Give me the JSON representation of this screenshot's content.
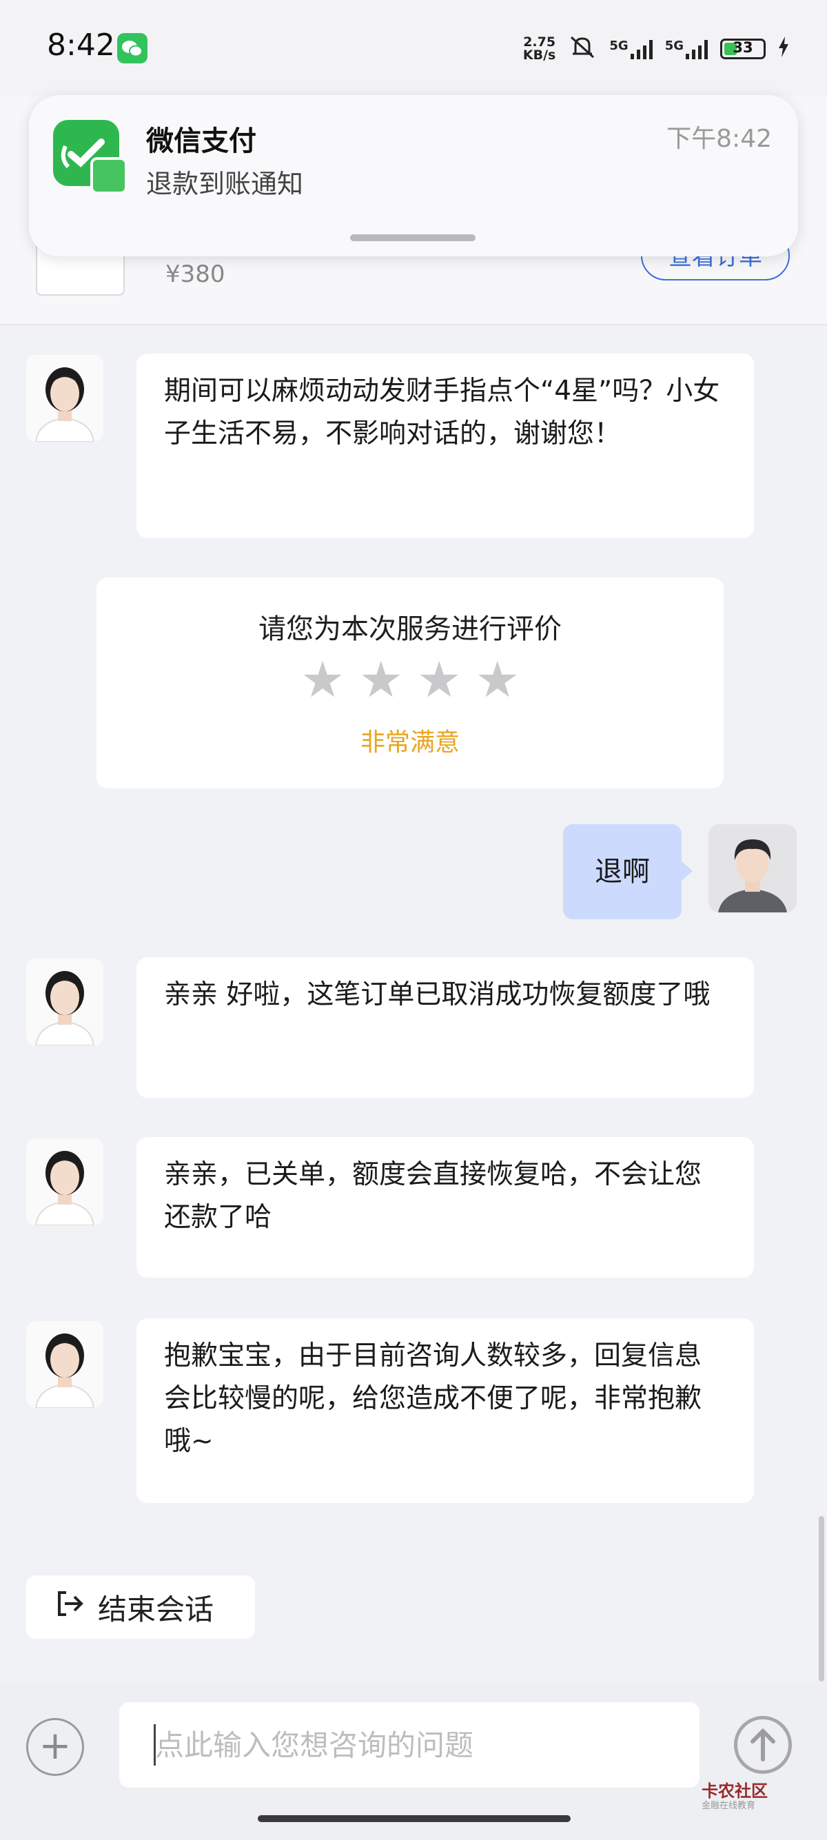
{
  "status_bar": {
    "time": "8:42",
    "net_speed_value": "2.75",
    "net_speed_unit": "KB/s",
    "signal1": "5G",
    "signal2": "5G",
    "battery": "33"
  },
  "order_card": {
    "price": "¥380",
    "view_order_label": "查看订单"
  },
  "notification": {
    "app": "微信支付",
    "message": "退款到账通知",
    "time": "下午8:42"
  },
  "messages": [
    {
      "from": "agent",
      "text": "期间可以麻烦动动发财手指点个“4星”吗？小女子生活不易，不影响对话的，谢谢您！"
    },
    {
      "from": "user",
      "text": "退啊"
    },
    {
      "from": "agent",
      "text": "亲亲 好啦，这笔订单已取消成功恢复额度了哦"
    },
    {
      "from": "agent",
      "text": "亲亲，已关单，额度会直接恢复哈，不会让您还款了哈"
    },
    {
      "from": "agent",
      "text": "抱歉宝宝，由于目前咨询人数较多，回复信息会比较慢的呢，给您造成不便了呢，非常抱歉哦~"
    }
  ],
  "rating": {
    "title": "请您为本次服务进行评价",
    "stars_filled": 0,
    "stars_total": 4,
    "label": "非常满意",
    "label_color": "#e7a521"
  },
  "end_chat_label": "结束会话",
  "input": {
    "placeholder": "点此输入您想咨询的问题"
  },
  "watermark": {
    "name": "卡农社区",
    "sub": "金融在线教育"
  },
  "colors": {
    "accent": "#3b6fde",
    "user_bubble": "#ccdafd",
    "wechat_green": "#2fb74f"
  }
}
